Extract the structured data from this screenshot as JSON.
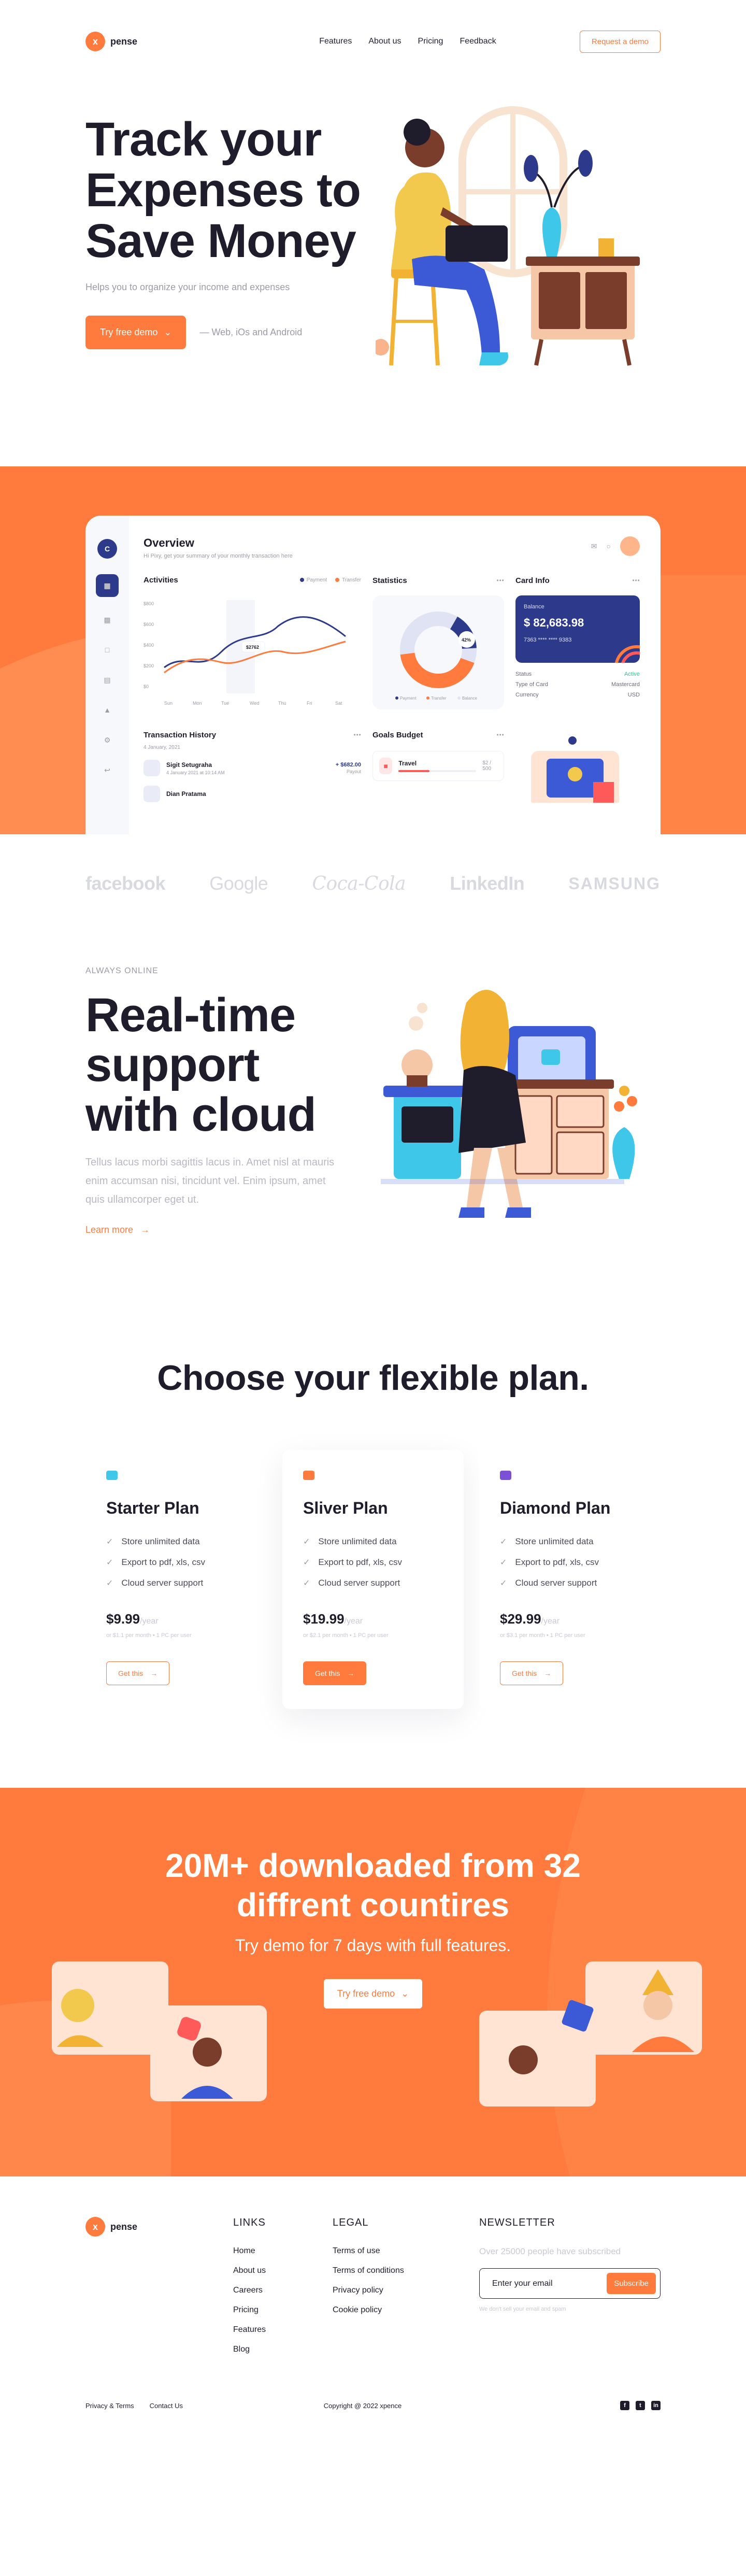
{
  "header": {
    "logo_mark": "x",
    "logo_text": "pense",
    "nav": [
      "Features",
      "About us",
      "Pricing",
      "Feedback"
    ],
    "cta": "Request a demo"
  },
  "hero": {
    "title_lines": [
      "Track your",
      "Expenses to",
      "Save Money"
    ],
    "subtitle": "Helps you to organize your income and expenses",
    "primary_button": "Try free demo",
    "platforms": "— Web, iOs and Android"
  },
  "dashboard": {
    "logo": "C",
    "title": "Overview",
    "subtitle": "Hi Pixy, get your summary of your monthly transaction here",
    "activities": {
      "title": "Activities",
      "legend": [
        "Payment",
        "Transfer"
      ],
      "y_ticks": [
        "$800",
        "$600",
        "$400",
        "$200",
        "$0"
      ],
      "x_ticks": [
        "Sun",
        "Mon",
        "Tue",
        "Wed",
        "Thu",
        "Fri",
        "Sat"
      ],
      "tooltip": "$2762"
    },
    "statistics": {
      "title": "Statistics",
      "center": "42%",
      "legend": [
        "Payment",
        "Transfer",
        "Balance"
      ]
    },
    "card_info": {
      "title": "Card Info",
      "label": "Balance",
      "amount": "$ 82,683.98",
      "number": "7363 **** **** 9383",
      "rows": [
        {
          "k": "Status",
          "v": "Active"
        },
        {
          "k": "Type of Card",
          "v": "Mastercard"
        },
        {
          "k": "Currency",
          "v": "USD"
        }
      ]
    },
    "transactions": {
      "title": "Transaction History",
      "date": "4 January, 2021",
      "items": [
        {
          "name": "Sigit Setugraha",
          "meta": "4 January 2021 at 10:14 AM",
          "amount": "+ $682.00",
          "status": "Payout"
        },
        {
          "name": "Dian Pratama",
          "meta": "",
          "amount": "",
          "status": ""
        }
      ]
    },
    "goals": {
      "title": "Goals Budget",
      "item": "Travel",
      "value": "$2 / 500",
      "progress": 0.4
    }
  },
  "brands": [
    "facebook",
    "Google",
    "Coca-Cola",
    "LinkedIn",
    "SAMSUNG"
  ],
  "support": {
    "eyebrow": "ALWAYS ONLINE",
    "title_lines": [
      "Real-time",
      "support",
      "with cloud"
    ],
    "body": "Tellus lacus morbi sagittis lacus in. Amet nisl at mauris enim accumsan nisi, tincidunt vel. Enim ipsum, amet quis ullamcorper eget ut.",
    "link": "Learn more"
  },
  "pricing": {
    "title": "Choose your flexible plan.",
    "plans": [
      {
        "name": "Starter Plan",
        "icon_color": "#3ec7e8",
        "features": [
          "Store unlimited data",
          "Export to pdf, xls, csv",
          "Cloud server support"
        ],
        "price": "$9.99",
        "per": "/year",
        "note": "or $1.1 per month • 1 PC per user",
        "button": "Get this"
      },
      {
        "name": "Sliver Plan",
        "icon_color": "#ff7a3d",
        "features": [
          "Store unlimited data",
          "Export to pdf, xls, csv",
          "Cloud server support"
        ],
        "price": "$19.99",
        "per": "/year",
        "note": "or $2.1 per month • 1 PC per user",
        "button": "Get this"
      },
      {
        "name": "Diamond Plan",
        "icon_color": "#7b4fd6",
        "features": [
          "Store unlimited data",
          "Export to pdf, xls, csv",
          "Cloud server support"
        ],
        "price": "$29.99",
        "per": "/year",
        "note": "or $3.1 per month • 1 PC per user",
        "button": "Get this"
      }
    ]
  },
  "cta": {
    "title_lines": [
      "20M+ downloaded from 32",
      "diffrent countires"
    ],
    "subtitle": "Try demo for 7 days with full features.",
    "button": "Try free demo"
  },
  "footer": {
    "logo_mark": "x",
    "logo_text": "pense",
    "links_title": "LINKS",
    "links": [
      "Home",
      "About us",
      "Careers",
      "Pricing",
      "Features",
      "Blog"
    ],
    "legal_title": "LEGAL",
    "legal": [
      "Terms of use",
      "Terms of conditions",
      "Privacy policy",
      "Cookie policy"
    ],
    "newsletter_title": "NEWSLETTER",
    "newsletter_desc": "Over 25000 people have subscribed",
    "email_placeholder": "Enter your email",
    "subscribe": "Subscribe",
    "note": "We don't sell your email and spam",
    "bottom_links": [
      "Privacy & Terms",
      "Contact Us"
    ],
    "copyright": "Copyright @ 2022 xpence",
    "social": [
      "f",
      "t",
      "in"
    ]
  },
  "colors": {
    "accent": "#ff7a3d",
    "navy": "#2d3a8c",
    "text": "#1f1d2b",
    "muted": "#9b9ca5"
  }
}
